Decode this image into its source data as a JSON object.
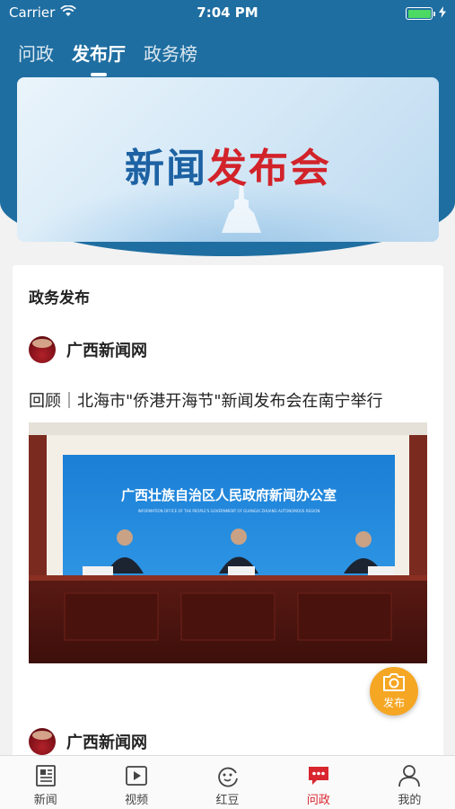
{
  "status_bar": {
    "carrier": "Carrier",
    "time": "7:04 PM"
  },
  "top_tabs": [
    {
      "label": "问政",
      "active": false
    },
    {
      "label": "发布厅",
      "active": true
    },
    {
      "label": "政务榜",
      "active": false
    }
  ],
  "banner": {
    "title_part1": "新闻",
    "title_part2": "发布会"
  },
  "section": {
    "title": "政务发布"
  },
  "posts": [
    {
      "source": "广西新闻网",
      "title": "回顾｜北海市\"侨港开海节\"新闻发布会在南宁举行",
      "photo": {
        "backdrop_text": "广西壮族自治区人民政府新闻办公室",
        "backdrop_subtext": "INFORMATION OFFICE OF THE PEOPLE'S GOVERNMENT OF GUANGXI ZHUANG AUTONOMOUS REGION"
      }
    },
    {
      "source": "广西新闻网"
    }
  ],
  "publish_button": {
    "label": "发布"
  },
  "tab_bar": [
    {
      "label": "新闻",
      "icon": "news-icon",
      "active": false
    },
    {
      "label": "视频",
      "icon": "video-icon",
      "active": false
    },
    {
      "label": "红豆",
      "icon": "hongdou-icon",
      "active": false
    },
    {
      "label": "问政",
      "icon": "wenzheng-icon",
      "active": true
    },
    {
      "label": "我的",
      "icon": "profile-icon",
      "active": false
    }
  ],
  "colors": {
    "header_blue": "#1f6ea1",
    "accent_red": "#d9252e",
    "publish_orange": "#f5a623"
  }
}
